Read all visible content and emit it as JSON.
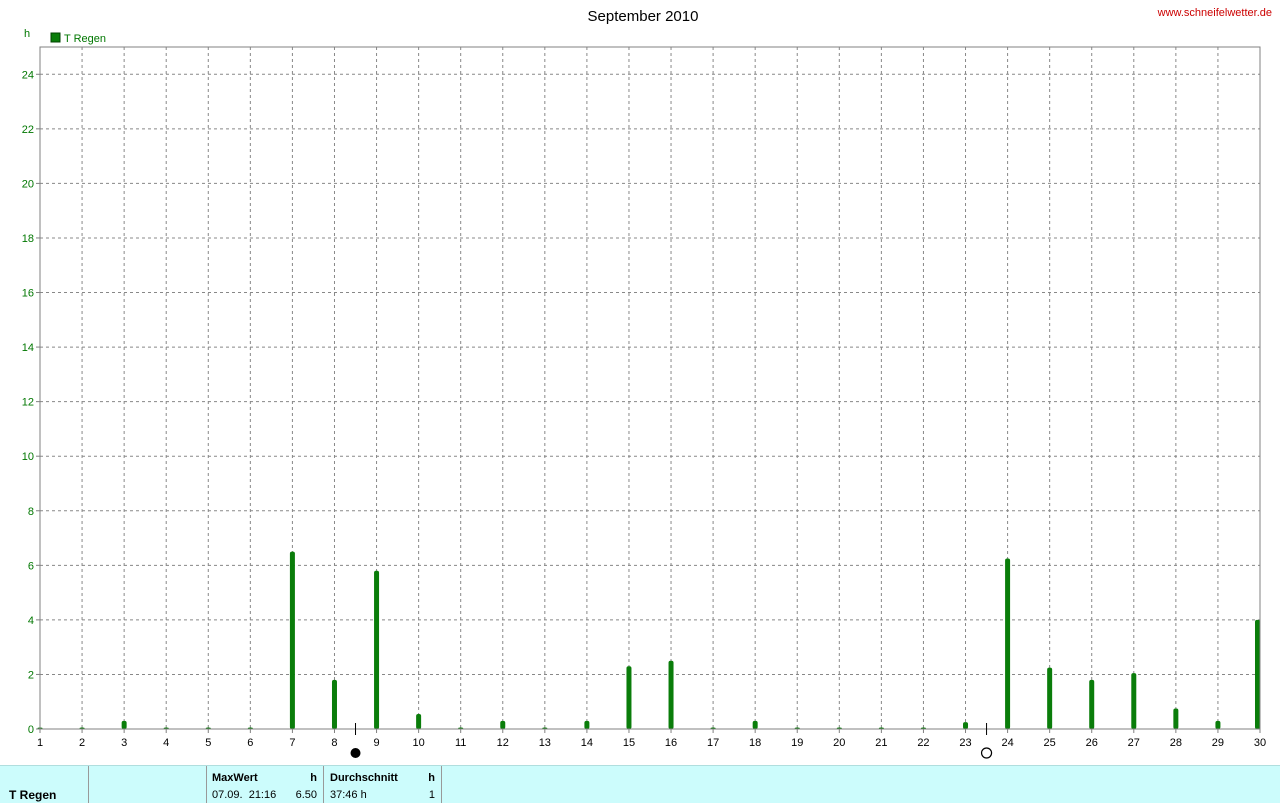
{
  "site_url": "www.schneifelwetter.de",
  "colors": {
    "series": "#0a7d0a",
    "axis_text": "#007700",
    "grid": "#888888",
    "footer_bg": "#ccfcfc",
    "site_text": "#cc0000"
  },
  "moon_phases": [
    {
      "day": 8.5,
      "icon": "new-moon-icon"
    },
    {
      "day": 23.5,
      "icon": "full-moon-icon"
    }
  ],
  "chart_data": {
    "type": "bar",
    "title": "September 2010",
    "ylabel": "h",
    "xlabel": "",
    "xlim": [
      1,
      30
    ],
    "ylim": [
      0,
      25
    ],
    "yticks": [
      0,
      2,
      4,
      6,
      8,
      10,
      12,
      14,
      16,
      18,
      20,
      22,
      24
    ],
    "xticks": [
      1,
      2,
      3,
      4,
      5,
      6,
      7,
      8,
      9,
      10,
      11,
      12,
      13,
      14,
      15,
      16,
      17,
      18,
      19,
      20,
      21,
      22,
      23,
      24,
      25,
      26,
      27,
      28,
      29,
      30
    ],
    "grid": true,
    "legend_position": "top-left",
    "series": [
      {
        "name": "T Regen",
        "x": [
          1,
          2,
          3,
          4,
          5,
          6,
          7,
          8,
          9,
          10,
          11,
          12,
          13,
          14,
          15,
          16,
          17,
          18,
          19,
          20,
          21,
          22,
          23,
          24,
          25,
          26,
          27,
          28,
          29,
          30
        ],
        "values": [
          0,
          0,
          0.3,
          0,
          0,
          0,
          6.5,
          1.8,
          5.8,
          0.55,
          0,
          0.3,
          0,
          0.3,
          2.3,
          2.5,
          0,
          0.3,
          0,
          0,
          0,
          0,
          0.25,
          6.25,
          2.25,
          1.8,
          2.05,
          0.75,
          0.3,
          4.0
        ]
      }
    ]
  },
  "footer": {
    "series_label": "T Regen",
    "maxwert_label": "MaxWert",
    "maxwert_unit": "h",
    "maxwert_datetime": "07.09.  21:16",
    "maxwert_value": "6.50",
    "avg_label": "Durchschnitt",
    "avg_unit": "h",
    "avg_value": "37:46 h",
    "avg_count": "1"
  }
}
